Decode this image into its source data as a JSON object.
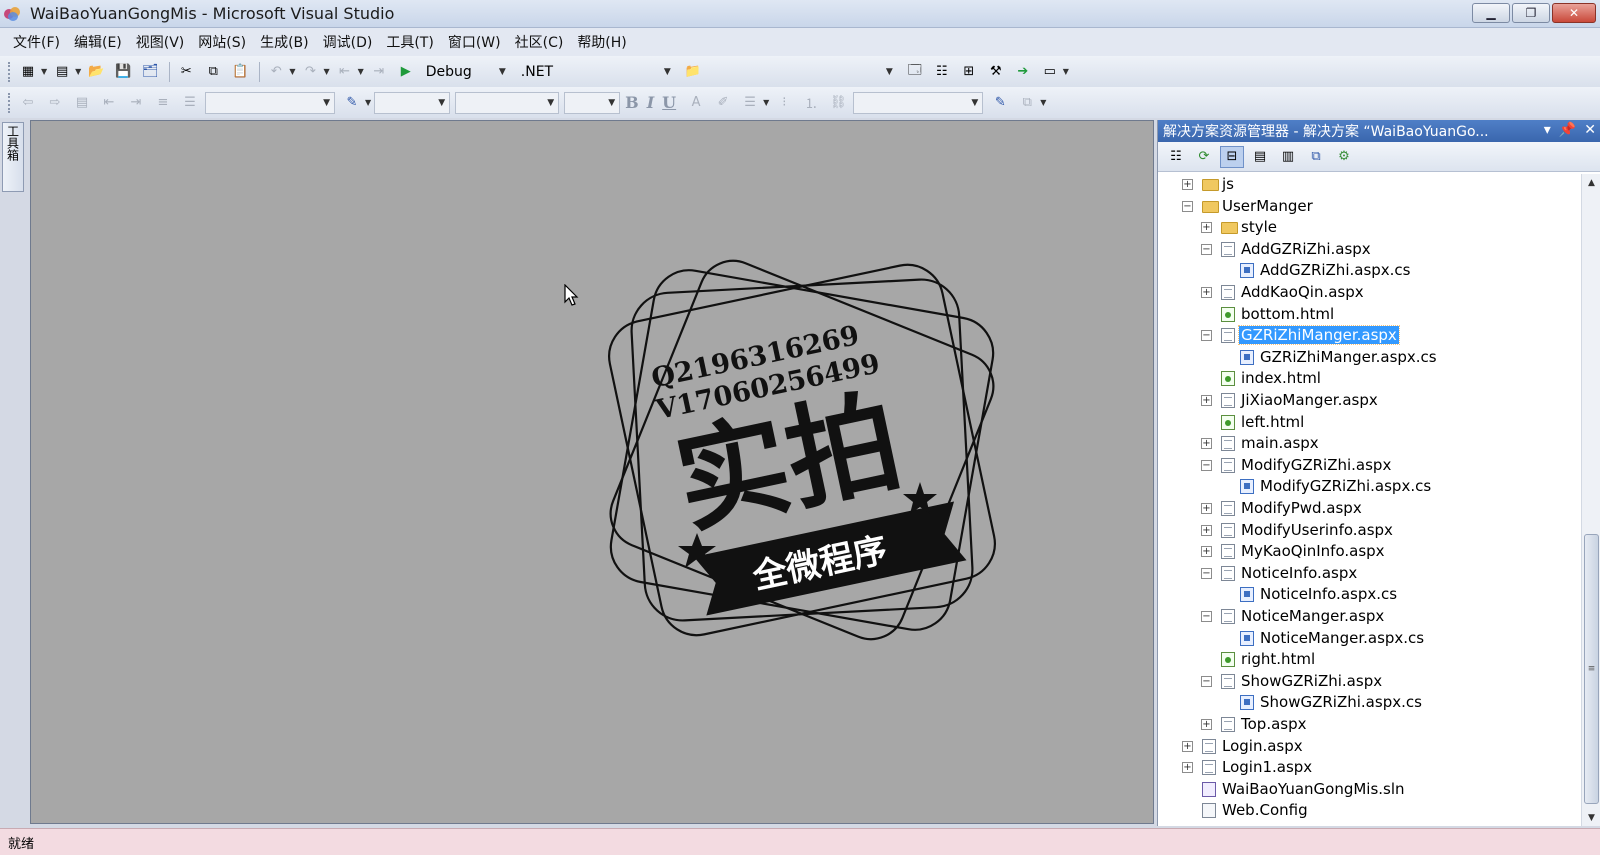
{
  "window": {
    "title": "WaiBaoYuanGongMis - Microsoft Visual Studio",
    "min": "▁",
    "restore": "❐",
    "close": "✕"
  },
  "menu": [
    "文件(F)",
    "编辑(E)",
    "视图(V)",
    "网站(S)",
    "生成(B)",
    "调试(D)",
    "工具(T)",
    "窗口(W)",
    "社区(C)",
    "帮助(H)"
  ],
  "toolbar": {
    "config": "Debug",
    "platform": ".NET",
    "bold": "B",
    "italic": "I",
    "underline": "U"
  },
  "toolbox": {
    "label": "工具箱"
  },
  "watermark": {
    "line1": "Q2196316269",
    "line2": "V17060256499",
    "big": "实拍",
    "banner": "全微程序"
  },
  "solution_explorer": {
    "title": "解决方案资源管理器 - 解决方案 “WaiBaoYuanGo...",
    "items": [
      {
        "label": "js",
        "type": "folder",
        "level": 0,
        "expander": "+"
      },
      {
        "label": "UserManger",
        "type": "folder",
        "level": 0,
        "expander": "−"
      },
      {
        "label": "style",
        "type": "folder",
        "level": 1,
        "expander": "+"
      },
      {
        "label": "AddGZRiZhi.aspx",
        "type": "page",
        "level": 1,
        "expander": "−"
      },
      {
        "label": "AddGZRiZhi.aspx.cs",
        "type": "cs",
        "level": 2,
        "expander": ""
      },
      {
        "label": "AddKaoQin.aspx",
        "type": "page",
        "level": 1,
        "expander": "+"
      },
      {
        "label": "bottom.html",
        "type": "html",
        "level": 1,
        "expander": ""
      },
      {
        "label": "GZRiZhiManger.aspx",
        "type": "page",
        "level": 1,
        "expander": "−",
        "selected": true
      },
      {
        "label": "GZRiZhiManger.aspx.cs",
        "type": "cs",
        "level": 2,
        "expander": ""
      },
      {
        "label": "index.html",
        "type": "html",
        "level": 1,
        "expander": ""
      },
      {
        "label": "JiXiaoManger.aspx",
        "type": "page",
        "level": 1,
        "expander": "+"
      },
      {
        "label": "left.html",
        "type": "html",
        "level": 1,
        "expander": ""
      },
      {
        "label": "main.aspx",
        "type": "page",
        "level": 1,
        "expander": "+"
      },
      {
        "label": "ModifyGZRiZhi.aspx",
        "type": "page",
        "level": 1,
        "expander": "−"
      },
      {
        "label": "ModifyGZRiZhi.aspx.cs",
        "type": "cs",
        "level": 2,
        "expander": ""
      },
      {
        "label": "ModifyPwd.aspx",
        "type": "page",
        "level": 1,
        "expander": "+"
      },
      {
        "label": "ModifyUserinfo.aspx",
        "type": "page",
        "level": 1,
        "expander": "+"
      },
      {
        "label": "MyKaoQinInfo.aspx",
        "type": "page",
        "level": 1,
        "expander": "+"
      },
      {
        "label": "NoticeInfo.aspx",
        "type": "page",
        "level": 1,
        "expander": "−"
      },
      {
        "label": "NoticeInfo.aspx.cs",
        "type": "cs",
        "level": 2,
        "expander": ""
      },
      {
        "label": "NoticeManger.aspx",
        "type": "page",
        "level": 1,
        "expander": "−"
      },
      {
        "label": "NoticeManger.aspx.cs",
        "type": "cs",
        "level": 2,
        "expander": ""
      },
      {
        "label": "right.html",
        "type": "html",
        "level": 1,
        "expander": ""
      },
      {
        "label": "ShowGZRiZhi.aspx",
        "type": "page",
        "level": 1,
        "expander": "−"
      },
      {
        "label": "ShowGZRiZhi.aspx.cs",
        "type": "cs",
        "level": 2,
        "expander": ""
      },
      {
        "label": "Top.aspx",
        "type": "page",
        "level": 1,
        "expander": "+"
      },
      {
        "label": "Login.aspx",
        "type": "page",
        "level": 0,
        "expander": "+"
      },
      {
        "label": "Login1.aspx",
        "type": "page",
        "level": 0,
        "expander": "+"
      },
      {
        "label": "WaiBaoYuanGongMis.sln",
        "type": "sln",
        "level": 0,
        "expander": ""
      },
      {
        "label": "Web.Config",
        "type": "config",
        "level": 0,
        "expander": ""
      }
    ]
  },
  "status": {
    "text": "就绪"
  }
}
